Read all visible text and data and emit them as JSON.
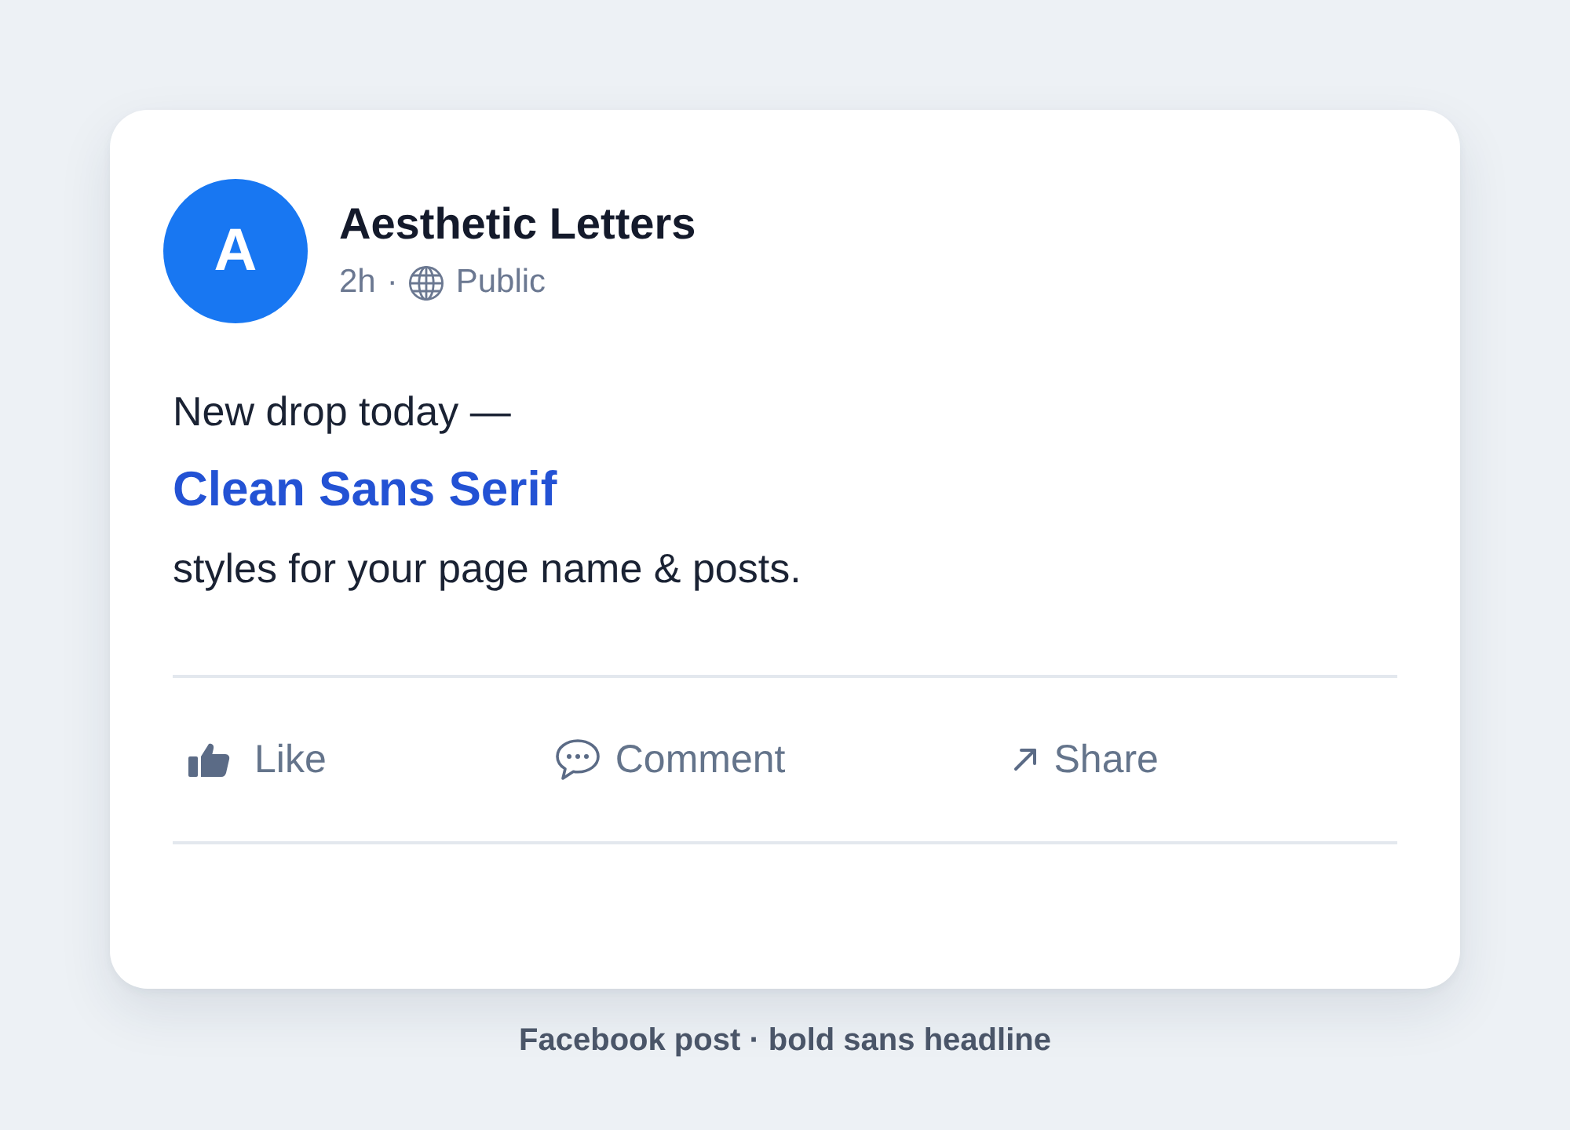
{
  "post": {
    "author": {
      "initial": "A",
      "name": "Aesthetic Letters"
    },
    "time": "2h",
    "separator": "·",
    "audience": "Public",
    "body": [
      {
        "kind": "plain",
        "text": "New drop today —"
      },
      {
        "kind": "headline",
        "text": "Clean Sans Serif"
      },
      {
        "kind": "plain",
        "text": "styles for your page name & posts."
      }
    ],
    "actions": [
      {
        "kind": "like",
        "label": "Like"
      },
      {
        "kind": "comment",
        "label": "Comment"
      },
      {
        "kind": "share",
        "label": "Share"
      }
    ]
  },
  "caption": "Facebook post · bold sans headline"
}
